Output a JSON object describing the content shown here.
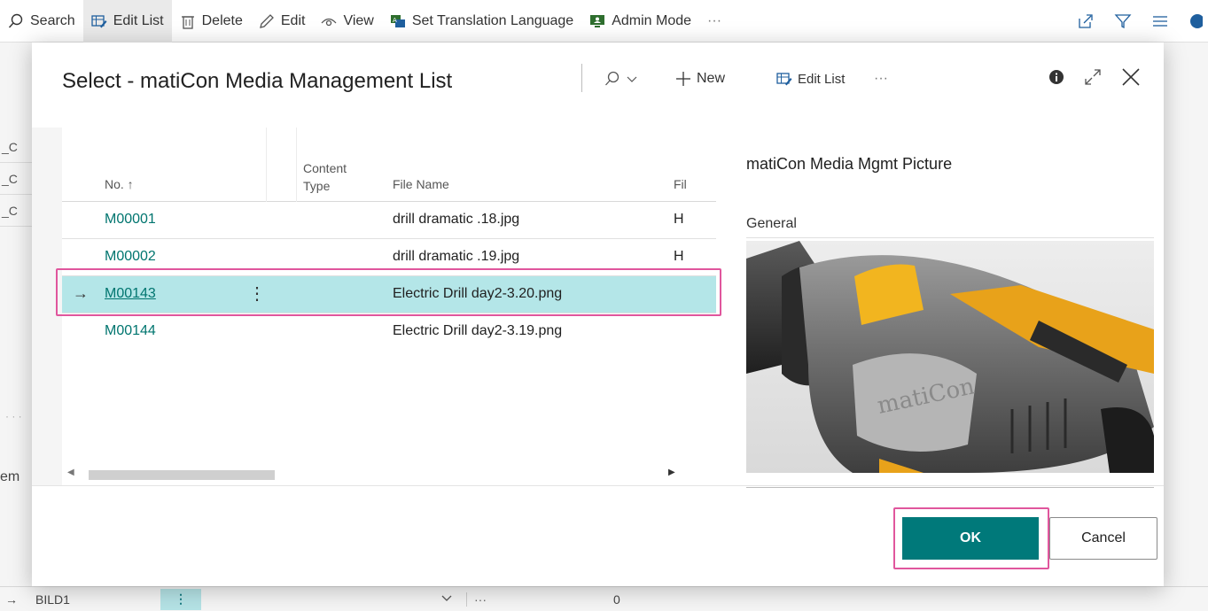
{
  "background": {
    "toolbar": {
      "search": "Search",
      "edit_list": "Edit List",
      "delete": "Delete",
      "edit": "Edit",
      "view": "View",
      "set_translation": "Set Translation Language",
      "admin_mode": "Admin Mode",
      "more": "···"
    },
    "left_rows": [
      "_C",
      "_C",
      "_C"
    ],
    "left_bottom_label": "em",
    "left_dots": "· · ·",
    "bottom_row": {
      "arrow": "→",
      "code": "BILD1",
      "more": "···",
      "value": "0"
    }
  },
  "dialog": {
    "title": "Select - matiCon Media Management List",
    "new_label": "New",
    "edit_list_label": "Edit List",
    "more_label": "···",
    "columns": {
      "no": "No. ↑",
      "content_type_line1": "Content",
      "content_type_line2": "Type",
      "file_name": "File Name",
      "fil": "Fil"
    },
    "rows": [
      {
        "no": "M00001",
        "file_name": "drill dramatic .18.jpg",
        "fil": "H"
      },
      {
        "no": "M00002",
        "file_name": "drill dramatic .19.jpg",
        "fil": "H"
      },
      {
        "no": "M00143",
        "file_name": "Electric Drill day2-3.20.png",
        "fil": ""
      },
      {
        "no": "M00144",
        "file_name": "Electric Drill day2-3.19.png",
        "fil": ""
      }
    ],
    "selected_arrow": "→",
    "kebab": "⋮",
    "panel": {
      "title": "matiCon Media Mgmt Picture",
      "subtitle": "General",
      "picture_brand": "matiCon"
    },
    "ok_label": "OK",
    "cancel_label": "Cancel",
    "accent_color": "#00797a",
    "highlight_color": "#e0569d"
  }
}
